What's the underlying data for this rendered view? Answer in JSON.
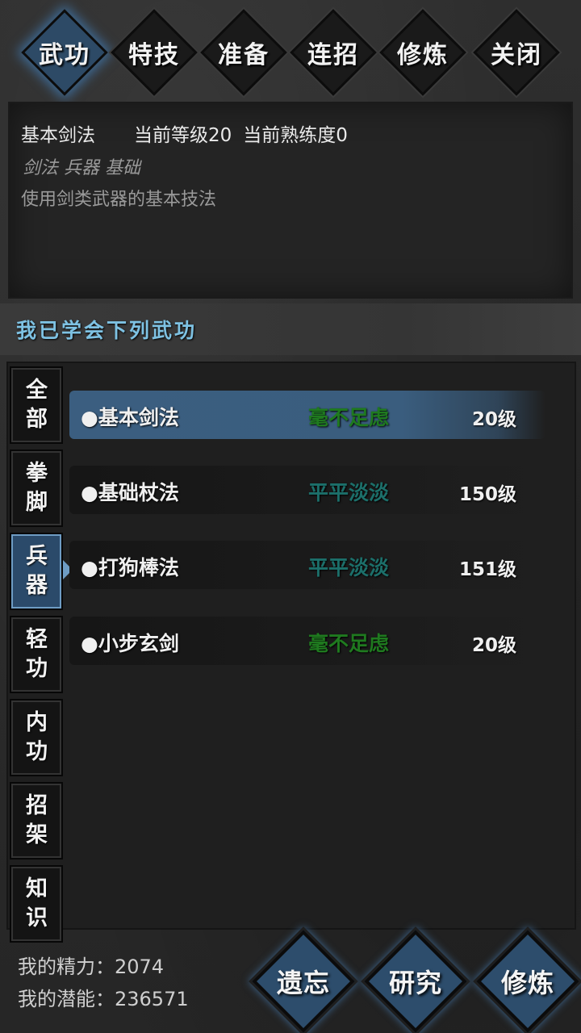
{
  "tabs": [
    {
      "label": "武功",
      "active": true
    },
    {
      "label": "特技",
      "active": false
    },
    {
      "label": "准备",
      "active": false
    },
    {
      "label": "连招",
      "active": false
    },
    {
      "label": "修炼",
      "active": false
    },
    {
      "label": "关闭",
      "active": false
    }
  ],
  "info": {
    "name": "基本剑法",
    "level_text": "当前等级20",
    "proficiency_text": "当前熟练度0",
    "tags": "剑法 兵器 基础",
    "description": "使用剑类武器的基本技法"
  },
  "learned_title": "我已学会下列武功",
  "categories": [
    {
      "label": "全部",
      "active": false
    },
    {
      "label": "拳脚",
      "active": false
    },
    {
      "label": "兵器",
      "active": true
    },
    {
      "label": "轻功",
      "active": false
    },
    {
      "label": "内功",
      "active": false
    },
    {
      "label": "招架",
      "active": false
    },
    {
      "label": "知识",
      "active": false
    }
  ],
  "skills": [
    {
      "name": "●基本剑法",
      "rank": "毫不足虑",
      "rank_color": "#1f7a1f",
      "level": "20级",
      "active": true
    },
    {
      "name": "●基础杖法",
      "rank": "平平淡淡",
      "rank_color": "#1c6f6a",
      "level": "150级",
      "active": false
    },
    {
      "name": "●打狗棒法",
      "rank": "平平淡淡",
      "rank_color": "#1c6f6a",
      "level": "151级",
      "active": false
    },
    {
      "name": "●小步玄剑",
      "rank": "毫不足虑",
      "rank_color": "#1f7a1f",
      "level": "20级",
      "active": false
    }
  ],
  "stats": {
    "energy": "我的精力：2074",
    "potential": "我的潜能：236571"
  },
  "actions": [
    "遗忘",
    "研究",
    "修炼"
  ],
  "colors": {
    "accent": "#3b5e80",
    "title_blue": "#7ec2e3"
  }
}
